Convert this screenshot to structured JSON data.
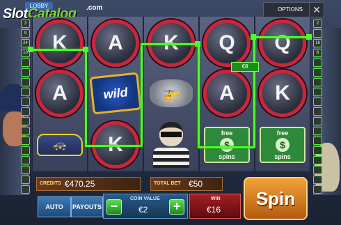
{
  "header": {
    "lobby_label": "LOBBY",
    "logo_part1": "Slot",
    "logo_part2": "Catalog",
    "logo_suffix": ".com",
    "options_label": "OPTIONS",
    "close_glyph": "✕"
  },
  "paylines": {
    "left": [
      "3",
      "9",
      "24",
      "10",
      "",
      "",
      "",
      "",
      "",
      "",
      "",
      "",
      "",
      "",
      "",
      "",
      "",
      ""
    ],
    "right": [
      "2",
      "",
      "16",
      "6",
      "",
      "",
      "",
      "",
      "",
      "",
      "",
      "",
      "",
      "",
      "",
      "",
      "",
      ""
    ]
  },
  "reels": [
    [
      "K",
      "A",
      "car"
    ],
    [
      "A",
      "wild",
      "K"
    ],
    [
      "K",
      "helicopter",
      "robber"
    ],
    [
      "Q",
      "A",
      "free-spins"
    ],
    [
      "Q",
      "K",
      "free-spins"
    ]
  ],
  "symbols": {
    "wild_label": "wild",
    "free_top": "free",
    "free_bottom": "spins",
    "dollar": "$"
  },
  "win_badge": "€8",
  "bottom": {
    "credits_label": "CREDITS",
    "credits_value": "€470.25",
    "total_bet_label": "TOTAL BET",
    "total_bet_value": "€50",
    "auto_label": "AUTO",
    "payouts_label": "PAYOUTS",
    "coin_value_label": "COIN VALUE",
    "coin_value": "€2",
    "minus_glyph": "−",
    "plus_glyph": "+",
    "win_label": "WIN",
    "win_value": "€16",
    "spin_label": "Spin"
  },
  "colors": {
    "win_line": "#4cff2a",
    "accent_red": "#c9263e",
    "spin_orange": "#f2a338"
  }
}
